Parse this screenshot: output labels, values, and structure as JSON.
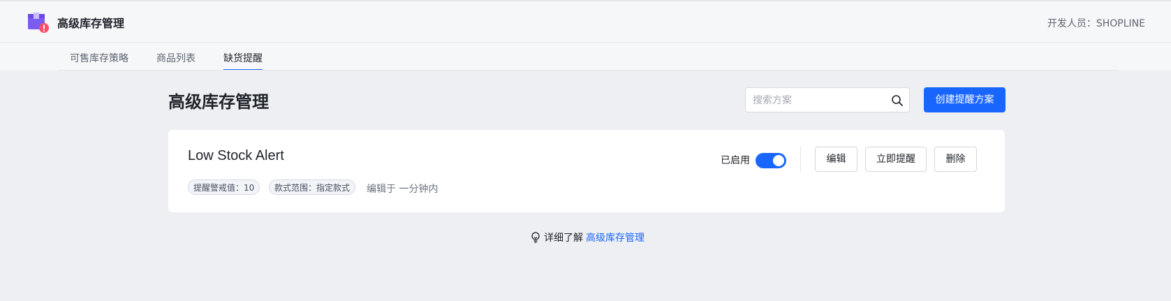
{
  "header": {
    "app_title": "高级库存管理",
    "developer": "开发人员：SHOPLINE",
    "logo_icon": "inventory-box-alert-icon"
  },
  "tabs": [
    {
      "label": "可售库存策略",
      "active": false
    },
    {
      "label": "商品列表",
      "active": false
    },
    {
      "label": "缺货提醒",
      "active": true
    }
  ],
  "main": {
    "page_title": "高级库存管理",
    "search": {
      "placeholder": "搜索方案",
      "value": ""
    },
    "create_button": "创建提醒方案"
  },
  "alert_card": {
    "title": "Low Stock Alert",
    "tags": [
      "提醒警戒值：10",
      "款式范围：指定款式"
    ],
    "edited_text": "编辑于 一分钟内",
    "status_label": "已启用",
    "enabled": true,
    "actions": {
      "edit": "编辑",
      "notify_now": "立即提醒",
      "delete": "删除"
    }
  },
  "footer": {
    "prefix": "详细了解",
    "link": "高级库存管理"
  },
  "colors": {
    "accent": "#1966ff",
    "page_bg": "#edeff2",
    "header_bg": "#f6f7f9"
  }
}
